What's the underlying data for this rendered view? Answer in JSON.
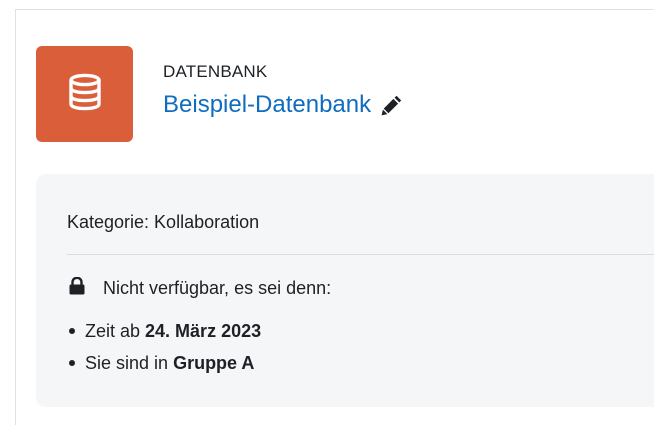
{
  "activity": {
    "type_label": "DATENBANK",
    "title": "Beispiel-Datenbank",
    "icon": "database-icon",
    "edit_icon": "pencil-icon",
    "icon_bg_color": "#db5e3b"
  },
  "info": {
    "category": "Kategorie: Kollaboration",
    "restriction_icon": "lock-icon",
    "restriction_title": "Nicht verfügbar, es sei denn:",
    "conditions": [
      {
        "prefix": "Zeit ab",
        "value": "24. März 2023"
      },
      {
        "prefix": "Sie sind in",
        "value": "Gruppe A"
      }
    ]
  }
}
